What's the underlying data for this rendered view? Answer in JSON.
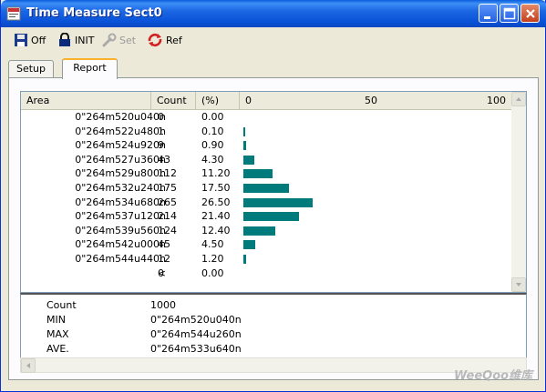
{
  "window": {
    "title": "Time Measure Sect0"
  },
  "toolbar": {
    "items": [
      {
        "label": "Off",
        "icon": "save-icon",
        "enabled": true
      },
      {
        "label": "INIT",
        "icon": "lock-icon",
        "enabled": true
      },
      {
        "label": "Set",
        "icon": "wrench-icon",
        "enabled": false
      },
      {
        "label": "Ref",
        "icon": "refresh-icon",
        "enabled": true
      }
    ]
  },
  "tabs": [
    {
      "label": "Setup",
      "active": false
    },
    {
      "label": "Report",
      "active": true
    }
  ],
  "table": {
    "headers": {
      "area": "Area",
      "count": "Count",
      "pct": "(%)"
    },
    "scale": {
      "min": "0",
      "mid": "50",
      "max": "100"
    },
    "rows": [
      {
        "area": "0\"264m520u040n",
        "count": "0",
        "pct": "0.00",
        "value": 0.0
      },
      {
        "area": "0\"264m522u480n",
        "count": "1",
        "pct": "0.10",
        "value": 0.1
      },
      {
        "area": "0\"264m524u920n",
        "count": "9",
        "pct": "0.90",
        "value": 0.9
      },
      {
        "area": "0\"264m527u360n",
        "count": "43",
        "pct": "4.30",
        "value": 4.3
      },
      {
        "area": "0\"264m529u800n",
        "count": "112",
        "pct": "11.20",
        "value": 11.2
      },
      {
        "area": "0\"264m532u240n",
        "count": "175",
        "pct": "17.50",
        "value": 17.5
      },
      {
        "area": "0\"264m534u680n",
        "count": "265",
        "pct": "26.50",
        "value": 26.5
      },
      {
        "area": "0\"264m537u120n",
        "count": "214",
        "pct": "21.40",
        "value": 21.4
      },
      {
        "area": "0\"264m539u560n",
        "count": "124",
        "pct": "12.40",
        "value": 12.4
      },
      {
        "area": "0\"264m542u000n",
        "count": "45",
        "pct": "4.50",
        "value": 4.5
      },
      {
        "area": "0\"264m544u440n",
        "count": "12",
        "pct": "1.20",
        "value": 1.2
      },
      {
        "area": "<",
        "count": "0",
        "pct": "0.00",
        "value": 0.0
      }
    ]
  },
  "summary": [
    {
      "label": "Count",
      "value": "1000"
    },
    {
      "label": "MIN",
      "value": "0\"264m520u040n"
    },
    {
      "label": "MAX",
      "value": "0\"264m544u260n"
    },
    {
      "label": "AVE.",
      "value": "0\"264m533u640n"
    }
  ],
  "watermark": "WeeQoo维库",
  "colors": {
    "bar": "#007b7b",
    "titlebar": "#0a5cdc",
    "tab_highlight": "#f9b12a"
  }
}
